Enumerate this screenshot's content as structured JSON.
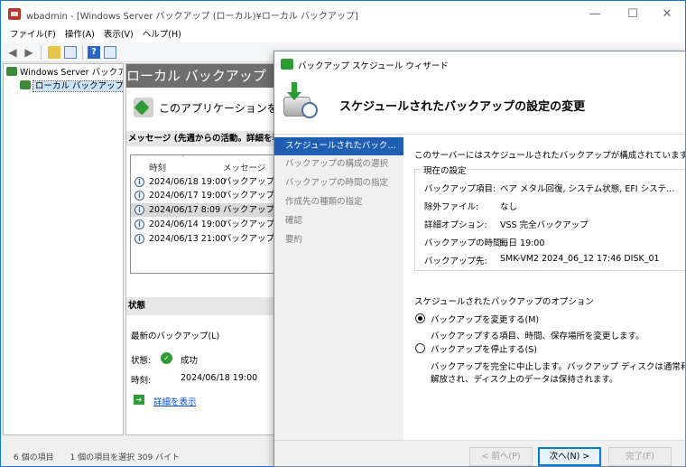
{
  "window": {
    "title": "wbadmin - [Windows Server バックアップ (ローカル)¥ローカル バックアップ]",
    "controls": {
      "minimize": "—",
      "maximize": "☐",
      "close": "✕"
    }
  },
  "menu": [
    "ファイル(F)",
    "操作(A)",
    "表示(V)",
    "ヘルプ(H)"
  ],
  "tree": {
    "root": "Windows Server バックアップ",
    "child": "ローカル バックアップ"
  },
  "content": {
    "header": "ローカル バックアップ",
    "banner": "このアプリケーションを使用",
    "messages_label": "メッセージ (先週からの活動。詳細を表示",
    "columns": [
      "時刻",
      "メッセージ"
    ],
    "rows": [
      {
        "time": "2024/06/18 19:00",
        "message": "バックアップ"
      },
      {
        "time": "2024/06/17 19:00",
        "message": "バックアップ"
      },
      {
        "time": "2024/06/17 8:09",
        "message": "バックアップ"
      },
      {
        "time": "2024/06/14 19:00",
        "message": "バックアップ"
      },
      {
        "time": "2024/06/13 21:00",
        "message": "バックアップ"
      }
    ],
    "state_label": "状態",
    "last_backup_label": "最新のバックアップ(L)",
    "status_key": "状態:",
    "status_value": "成功",
    "time_key": "時刻:",
    "time_value": "2024/06/18 19:00",
    "details_link": "詳細を表示"
  },
  "statusbar": "6 個の項目　　1 個の項目を選択 309 バイト",
  "wizard": {
    "title": "バックアップ スケジュール ウィザード",
    "heading": "スケジュールされたバックアップの設定の変更",
    "nav": [
      "スケジュールされたバックアップ...",
      "バックアップの構成の選択",
      "バックアップの時間の指定",
      "作成先の種類の指定",
      "確認",
      "要約"
    ],
    "intro": "このサーバーにはスケジュールされたバックアップが構成されています。",
    "current_settings": "現在の設定",
    "settings": [
      {
        "key": "バックアップ項目:",
        "value": "ベア メタル回復, システム状態, EFI システム パ..."
      },
      {
        "key": "除外ファイル:",
        "value": "なし"
      },
      {
        "key": "詳細オプション:",
        "value": "VSS 完全バックアップ"
      },
      {
        "key": "バックアップの時間:",
        "value": "毎日 19:00"
      },
      {
        "key": "バックアップ先:",
        "value": "SMK-VM2 2024_06_12 17:46 DISK_01"
      }
    ],
    "options_label": "スケジュールされたバックアップのオプション",
    "option1": {
      "label": "バックアップを変更する(M)",
      "desc": "バックアップする項目、時間、保存場所を変更します。"
    },
    "option2": {
      "label": "バックアップを停止する(S)",
      "desc1": "バックアップを完全に中止します。バックアップ ディスクは通常利用向けに",
      "desc2": "解放され、ディスク上のデータは保持されます。"
    },
    "buttons": {
      "back": "< 前へ(P)",
      "next": "次へ(N) >",
      "finish": "完了(F)"
    }
  }
}
